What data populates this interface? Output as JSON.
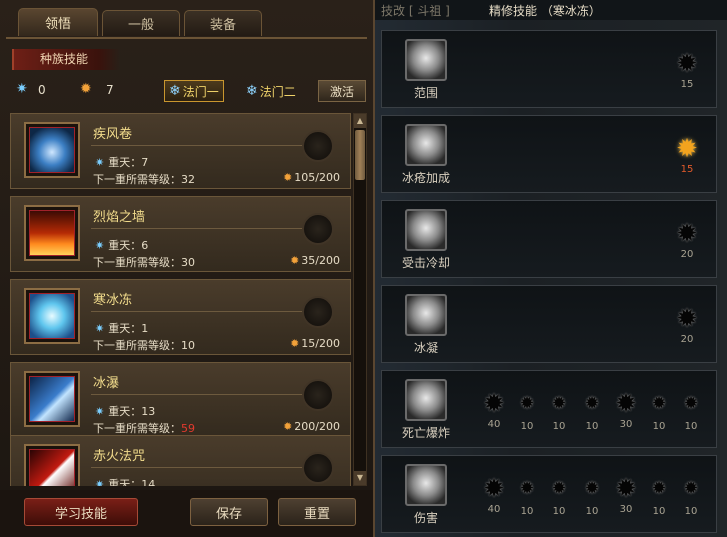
{
  "tabs": [
    "领悟",
    "一般",
    "装备"
  ],
  "section_title": "种族技能",
  "stats": {
    "ice_points": "0",
    "fire_points": "7"
  },
  "methods": {
    "method1": "法门一",
    "method2": "法门二",
    "activate": "激活"
  },
  "skills": [
    {
      "name": "疾风卷",
      "rank_label": "重天：7",
      "req_prefix": "下一重所需等级：",
      "req_level": "32",
      "req_red": false,
      "cost": "105/200",
      "icon": "wind"
    },
    {
      "name": "烈焰之墙",
      "rank_label": "重天：6",
      "req_prefix": "下一重所需等级：",
      "req_level": "30",
      "req_red": false,
      "cost": "35/200",
      "icon": "fire"
    },
    {
      "name": "寒冰冻",
      "rank_label": "重天：1",
      "req_prefix": "下一重所需等级：",
      "req_level": "10",
      "req_red": false,
      "cost": "15/200",
      "icon": "ice"
    },
    {
      "name": "冰瀑",
      "rank_label": "重天：13",
      "req_prefix": "下一重所需等级：",
      "req_level": "59",
      "req_red": true,
      "cost": "200/200",
      "icon": "storm"
    },
    {
      "name": "赤火法咒",
      "rank_label": "重天：14",
      "req_prefix": "",
      "req_level": "",
      "req_red": false,
      "cost": "",
      "icon": "curse"
    }
  ],
  "buttons": {
    "learn": "学习技能",
    "save": "保存",
    "reset": "重置"
  },
  "right": {
    "title_left": "技改 [ 斗祖 ]",
    "title": "精修技能 （寒冰冻）",
    "rows": [
      {
        "label": "范围",
        "nodes": [
          {
            "value": "15",
            "lit": false
          }
        ]
      },
      {
        "label": "冰疮加成",
        "nodes": [
          {
            "value": "15",
            "lit": true
          }
        ]
      },
      {
        "label": "受击冷却",
        "nodes": [
          {
            "value": "20",
            "lit": false
          }
        ]
      },
      {
        "label": "冰凝",
        "nodes": [
          {
            "value": "20",
            "lit": false
          }
        ]
      },
      {
        "label": "死亡爆炸",
        "nodes": [
          {
            "value": "40",
            "lit": false
          },
          {
            "value": "10",
            "lit": false
          },
          {
            "value": "10",
            "lit": false
          },
          {
            "value": "10",
            "lit": false
          },
          {
            "value": "30",
            "lit": false
          },
          {
            "value": "10",
            "lit": false
          },
          {
            "value": "10",
            "lit": false
          }
        ]
      },
      {
        "label": "伤害",
        "nodes": [
          {
            "value": "40",
            "lit": false
          },
          {
            "value": "10",
            "lit": false
          },
          {
            "value": "10",
            "lit": false
          },
          {
            "value": "10",
            "lit": false
          },
          {
            "value": "30",
            "lit": false
          },
          {
            "value": "10",
            "lit": false
          },
          {
            "value": "10",
            "lit": false
          }
        ]
      }
    ]
  },
  "colors": {
    "gold_text": "#f2dc8c",
    "ice_blue": "#8fd4ff",
    "fire_orange": "#f3a23a",
    "lit_node": "#f2a31e"
  }
}
